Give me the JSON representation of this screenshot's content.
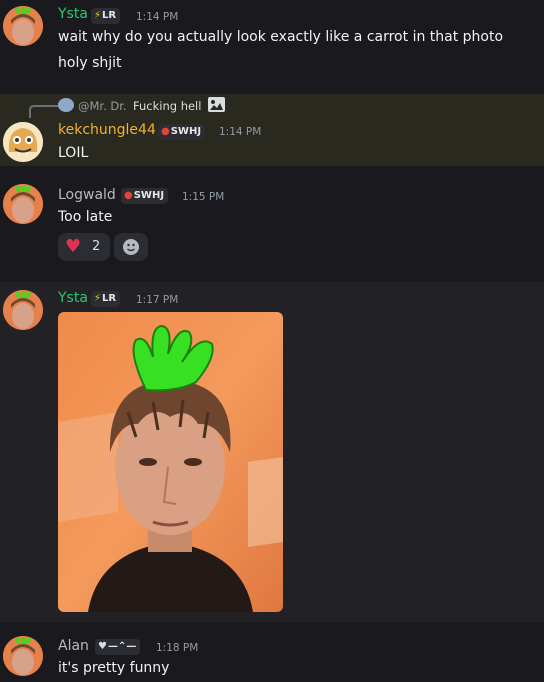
{
  "messages": [
    {
      "author": "Ysta",
      "tag": "LR",
      "time": "1:14 PM",
      "lines": [
        "wait why do you actually look exactly like a carrot in that photo",
        "holy shjit"
      ]
    },
    {
      "reply_to": {
        "author": "@Mr. Dr.",
        "text": "Fucking hell"
      },
      "author": "kekchungle44",
      "tag": "SWHJ",
      "time": "1:14 PM",
      "lines": [
        "LOIL"
      ]
    },
    {
      "author": "Logwald",
      "tag": "SWHJ",
      "time": "1:15 PM",
      "lines": [
        "Too late"
      ],
      "reactions": [
        {
          "icon": "heart-icon",
          "count": "2"
        },
        {
          "icon": "add-reaction-icon"
        }
      ]
    },
    {
      "author": "Ysta",
      "tag": "LR",
      "time": "1:17 PM",
      "attachment": "photo-of-man-with-green-carrot-top-drawn"
    },
    {
      "author": "Alan",
      "tag": "—⌃—",
      "time": "1:18 PM",
      "lines": [
        "it's pretty funny"
      ]
    }
  ],
  "colors": {
    "background": "#1a1a1e",
    "ysta": "#2dc770",
    "kek": "#f0b232",
    "logwald": "#b5bac1",
    "alan": "#b5bac1",
    "highlight": "#2a2920"
  }
}
